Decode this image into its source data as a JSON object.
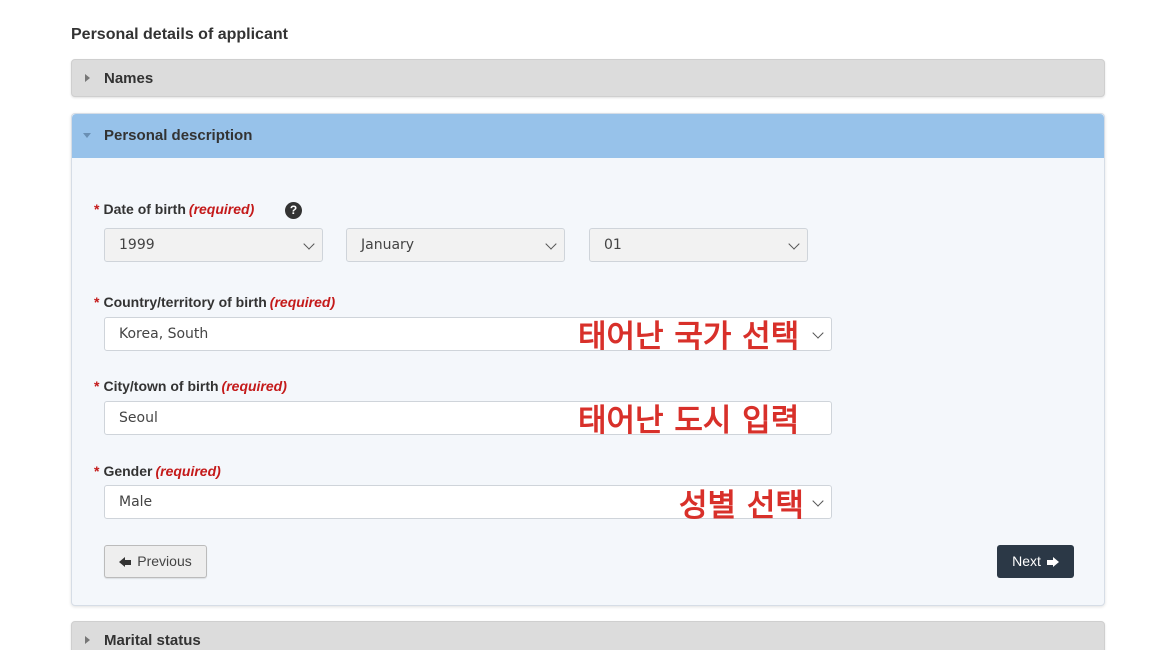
{
  "page": {
    "title": "Personal details of applicant"
  },
  "accordion": {
    "names": {
      "label": "Names"
    },
    "personal_description": {
      "label": "Personal description"
    },
    "marital_status": {
      "label": "Marital status"
    }
  },
  "form": {
    "required_marker": "*",
    "required_text": "(required)",
    "date_of_birth": {
      "label": "Date of birth",
      "year": "1999",
      "month": "January",
      "day": "01",
      "help_glyph": "?"
    },
    "country_of_birth": {
      "label": "Country/territory of birth",
      "value": "Korea, South"
    },
    "city_of_birth": {
      "label": "City/town of birth",
      "value": "Seoul"
    },
    "gender": {
      "label": "Gender",
      "value": "Male"
    }
  },
  "annotations": {
    "country": "태어난 국가 선택",
    "city": "태어난 도시 입력",
    "gender": "성별 선택"
  },
  "buttons": {
    "previous": "Previous",
    "next": "Next"
  },
  "icons": {
    "help": "question-circle-icon",
    "previous": "arrow-left-icon",
    "next": "arrow-right-icon",
    "dropdown": "chevron-down-icon",
    "accordion_collapsed": "caret-right-icon",
    "accordion_open": "caret-down-icon"
  },
  "colors": {
    "open_header": "#97c2ea",
    "required": "#c41a1a",
    "annotation": "#d8302a",
    "next_button": "#2b3846"
  }
}
